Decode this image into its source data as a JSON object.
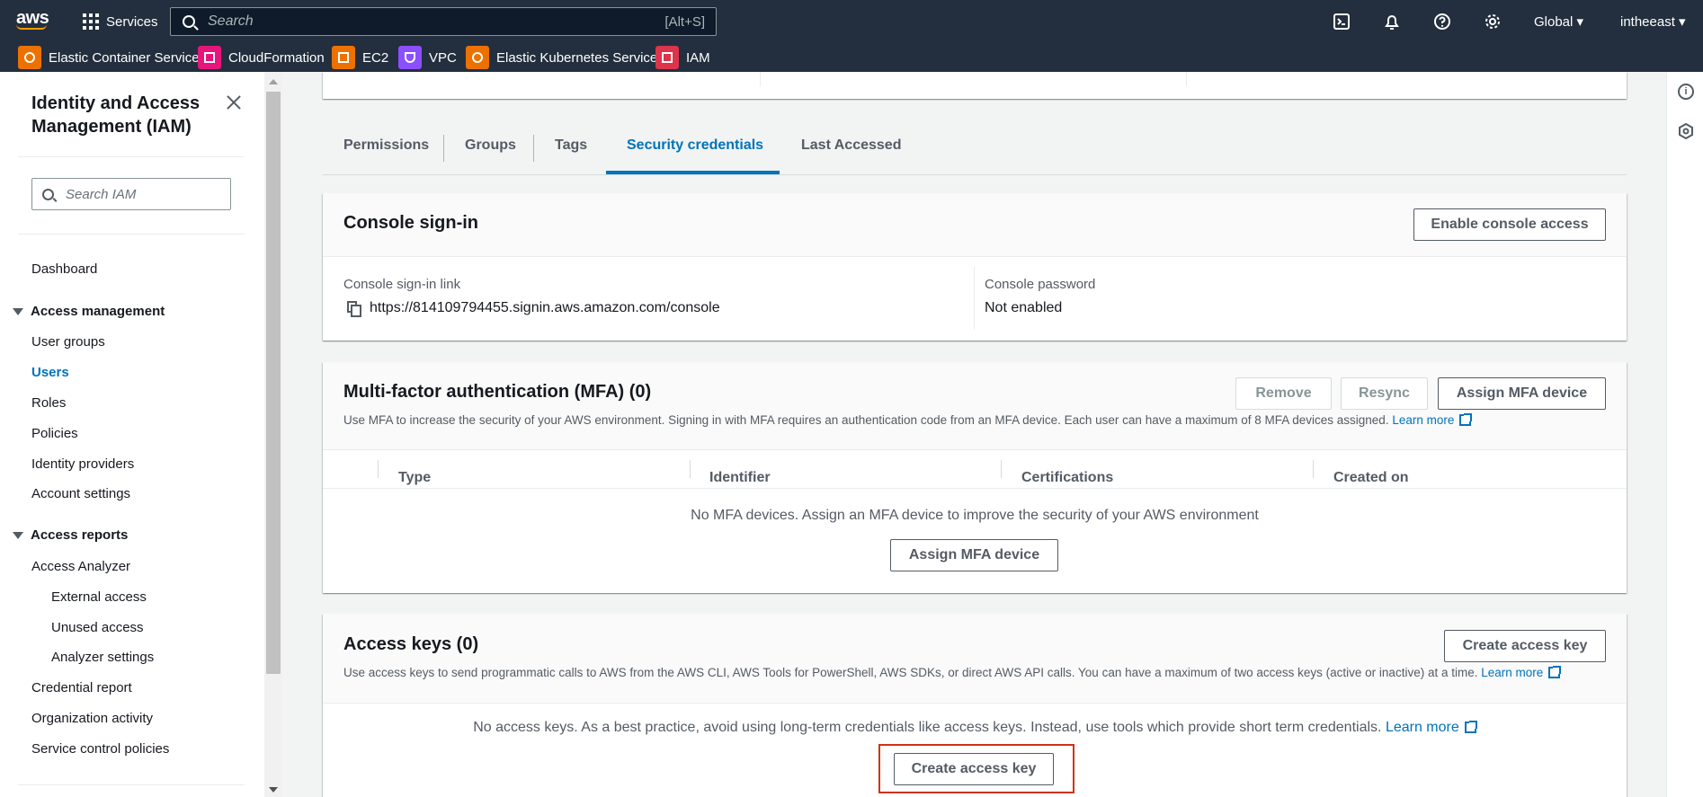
{
  "topnav": {
    "logo": "aws",
    "services_label": "Services",
    "search_placeholder": "Search",
    "search_shortcut": "[Alt+S]",
    "region": "Global ▾",
    "account": "intheeast ▾"
  },
  "favorites": [
    {
      "label": "Elastic Container Service",
      "color": "#ed7100"
    },
    {
      "label": "CloudFormation",
      "color": "#e7157b"
    },
    {
      "label": "EC2",
      "color": "#ed7100"
    },
    {
      "label": "VPC",
      "color": "#8c4fff"
    },
    {
      "label": "Elastic Kubernetes Service",
      "color": "#ed7100"
    },
    {
      "label": "IAM",
      "color": "#dd344c"
    }
  ],
  "sidebar": {
    "title": "Identity and Access Management (IAM)",
    "search_placeholder": "Search IAM",
    "dashboard": "Dashboard",
    "access_management": {
      "heading": "Access management",
      "items": [
        "User groups",
        "Users",
        "Roles",
        "Policies",
        "Identity providers",
        "Account settings"
      ]
    },
    "access_reports": {
      "heading": "Access reports",
      "analyzer": "Access Analyzer",
      "sub_items": [
        "External access",
        "Unused access",
        "Analyzer settings"
      ],
      "items": [
        "Credential report",
        "Organization activity",
        "Service control policies"
      ]
    }
  },
  "tabs": [
    "Permissions",
    "Groups",
    "Tags",
    "Security credentials",
    "Last Accessed"
  ],
  "console_signin": {
    "title": "Console sign-in",
    "enable_button": "Enable console access",
    "link_label": "Console sign-in link",
    "link_value": "https://814109794455.signin.aws.amazon.com/console",
    "password_label": "Console password",
    "password_value": "Not enabled"
  },
  "mfa": {
    "title": "Multi-factor authentication (MFA) (0)",
    "remove_button": "Remove",
    "resync_button": "Resync",
    "assign_button": "Assign MFA device",
    "description": "Use MFA to increase the security of your AWS environment. Signing in with MFA requires an authentication code from an MFA device. Each user can have a maximum of 8 MFA devices assigned.",
    "learn_more": "Learn more",
    "columns": [
      "Type",
      "Identifier",
      "Certifications",
      "Created on"
    ],
    "empty_message": "No MFA devices. Assign an MFA device to improve the security of your AWS environment",
    "empty_button": "Assign MFA device"
  },
  "access_keys": {
    "title": "Access keys (0)",
    "create_button": "Create access key",
    "description": "Use access keys to send programmatic calls to AWS from the AWS CLI, AWS Tools for PowerShell, AWS SDKs, or direct AWS API calls. You can have a maximum of two access keys (active or inactive) at a time.",
    "learn_more": "Learn more",
    "empty_message": "No access keys. As a best practice, avoid using long-term credentials like access keys. Instead, use tools which provide short term credentials.",
    "empty_learn_more": "Learn more",
    "empty_button": "Create access key"
  }
}
